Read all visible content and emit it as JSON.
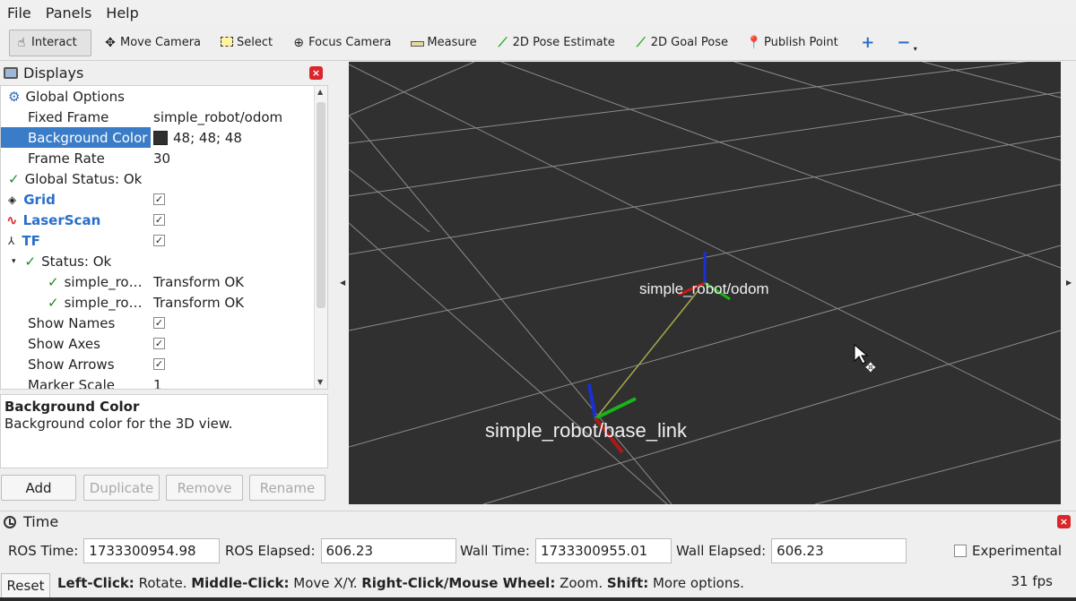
{
  "menu": {
    "items": [
      {
        "label": "File"
      },
      {
        "label": "Panels"
      },
      {
        "label": "Help"
      }
    ]
  },
  "toolbar": {
    "tools": [
      {
        "label": "Interact",
        "icon": "hand-pointer-icon"
      },
      {
        "label": "Move Camera",
        "icon": "move-camera-icon"
      },
      {
        "label": "Select",
        "icon": "select-box-icon"
      },
      {
        "label": "Focus Camera",
        "icon": "focus-camera-icon"
      },
      {
        "label": "Measure",
        "icon": "ruler-icon"
      },
      {
        "label": "2D Pose Estimate",
        "icon": "green-arrow-icon"
      },
      {
        "label": "2D Goal Pose",
        "icon": "green-arrow-icon"
      },
      {
        "label": "Publish Point",
        "icon": "map-pin-icon"
      }
    ]
  },
  "displays": {
    "title": "Displays",
    "tree": [
      {
        "label": "Global Options",
        "value": ""
      },
      {
        "label": "Fixed Frame",
        "value": "simple_robot/odom"
      },
      {
        "label": "Background Color",
        "value": "48; 48; 48"
      },
      {
        "label": "Frame Rate",
        "value": "30"
      },
      {
        "label": "Global Status: Ok",
        "value": ""
      },
      {
        "label": "Grid",
        "value": "✓"
      },
      {
        "label": "LaserScan",
        "value": "✓"
      },
      {
        "label": "TF",
        "value": "✓"
      },
      {
        "label": "Status: Ok",
        "value": ""
      },
      {
        "label": "simple_ro…",
        "value": "Transform OK"
      },
      {
        "label": "simple_ro…",
        "value": "Transform OK"
      },
      {
        "label": "Show Names",
        "value": "✓"
      },
      {
        "label": "Show Axes",
        "value": "✓"
      },
      {
        "label": "Show Arrows",
        "value": "✓"
      },
      {
        "label": "Marker Scale",
        "value": "1"
      }
    ],
    "description": {
      "title": "Background Color",
      "text": "Background color for the 3D view."
    },
    "buttons": {
      "add": "Add",
      "duplicate": "Duplicate",
      "remove": "Remove",
      "rename": "Rename"
    }
  },
  "view": {
    "background_color": "#303030",
    "frame_labels": {
      "odom": "simple_robot/odom",
      "base_link": "simple_robot/base_link"
    }
  },
  "time": {
    "title": "Time",
    "ros_time_label": "ROS Time:",
    "ros_time": "1733300954.98",
    "ros_elapsed_label": "ROS Elapsed:",
    "ros_elapsed": "606.23",
    "wall_time_label": "Wall Time:",
    "wall_time": "1733300955.01",
    "wall_elapsed_label": "Wall Elapsed:",
    "wall_elapsed": "606.23",
    "experimental_label": "Experimental"
  },
  "status": {
    "reset": "Reset",
    "hint_left_key": "Left-Click:",
    "hint_left_val": " Rotate. ",
    "hint_mid_key": "Middle-Click:",
    "hint_mid_val": " Move X/Y. ",
    "hint_right_key": "Right-Click/Mouse Wheel:",
    "hint_right_val": " Zoom. ",
    "hint_shift_key": "Shift:",
    "hint_shift_val": " More options.",
    "fps": "31 fps"
  }
}
